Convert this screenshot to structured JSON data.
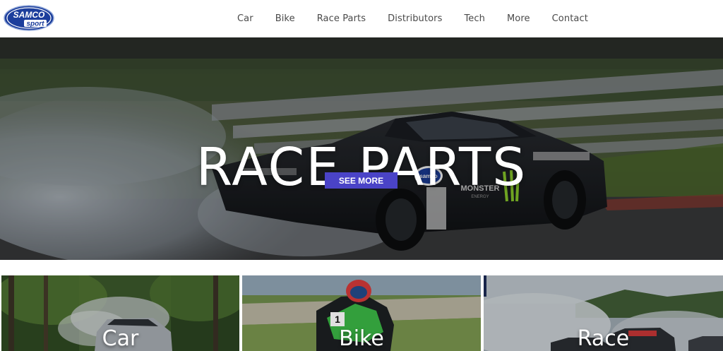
{
  "header": {
    "logo_top": "SAMCO",
    "logo_bottom": "sport",
    "nav": [
      "Car",
      "Bike",
      "Race Parts",
      "Distributors",
      "Tech",
      "More",
      "Contact"
    ]
  },
  "hero": {
    "title": "RACE PARTS",
    "cta": "SEE MORE",
    "car_sponsor": "MONSTER",
    "car_sponsor_sub": "ENERGY",
    "car_badge": "samco"
  },
  "tiles": [
    {
      "label": "Car"
    },
    {
      "label": "Bike"
    },
    {
      "label": "Race"
    }
  ],
  "colors": {
    "cta": "#4a43c7",
    "logo_blue": "#1c3e9c",
    "nav_text": "#4a4a4a"
  }
}
